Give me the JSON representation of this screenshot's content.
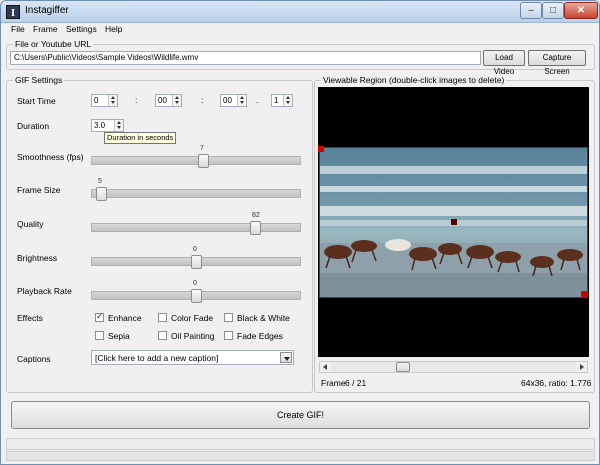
{
  "window": {
    "title": "Instagiffer",
    "icon_letter": "I"
  },
  "menu": [
    "File",
    "Frame",
    "Settings",
    "Help"
  ],
  "url_section": {
    "label": "File or Youtube URL",
    "value": "C:\\Users\\Public\\Videos\\Sample Videos\\Wildlife.wmv",
    "load_label": "Load Video",
    "capture_label": "Capture Screen"
  },
  "gif_settings": {
    "label": "GIF Settings",
    "start_time": {
      "label": "Start Time",
      "h": "0",
      "m": "00",
      "s": "00",
      "f": "1",
      "sep1": ":",
      "sep2": ":",
      "sep3": "."
    },
    "duration": {
      "label": "Duration",
      "value": "3.0",
      "tooltip": "Duration in seconds"
    },
    "smoothness": {
      "label": "Smoothness (fps)",
      "value": "7",
      "fraction": 0.54
    },
    "frame_size": {
      "label": "Frame Size",
      "value": "5",
      "fraction": 0.02
    },
    "quality": {
      "label": "Quality",
      "value": "82",
      "fraction": 0.8
    },
    "brightness": {
      "label": "Brightness",
      "value": "0",
      "fraction": 0.5
    },
    "playback_rate": {
      "label": "Playback Rate",
      "value": "0",
      "fraction": 0.5
    },
    "effects": {
      "label": "Effects",
      "items": [
        {
          "label": "Enhance",
          "checked": true
        },
        {
          "label": "Color Fade",
          "checked": false
        },
        {
          "label": "Black & White",
          "checked": false
        },
        {
          "label": "Sepia",
          "checked": false
        },
        {
          "label": "Oil Painting",
          "checked": false
        },
        {
          "label": "Fade Edges",
          "checked": false
        }
      ]
    },
    "captions": {
      "label": "Captions",
      "value": "[Click here to add a new caption]"
    }
  },
  "viewable_region": {
    "label": "Viewable Region (double-click images to delete)",
    "frame_label": "Frame",
    "frame_current": "6 / 21",
    "size_info": "64x36, ratio: 1.776",
    "scroll_fraction": 0.28
  },
  "create_label": "Create GIF!"
}
